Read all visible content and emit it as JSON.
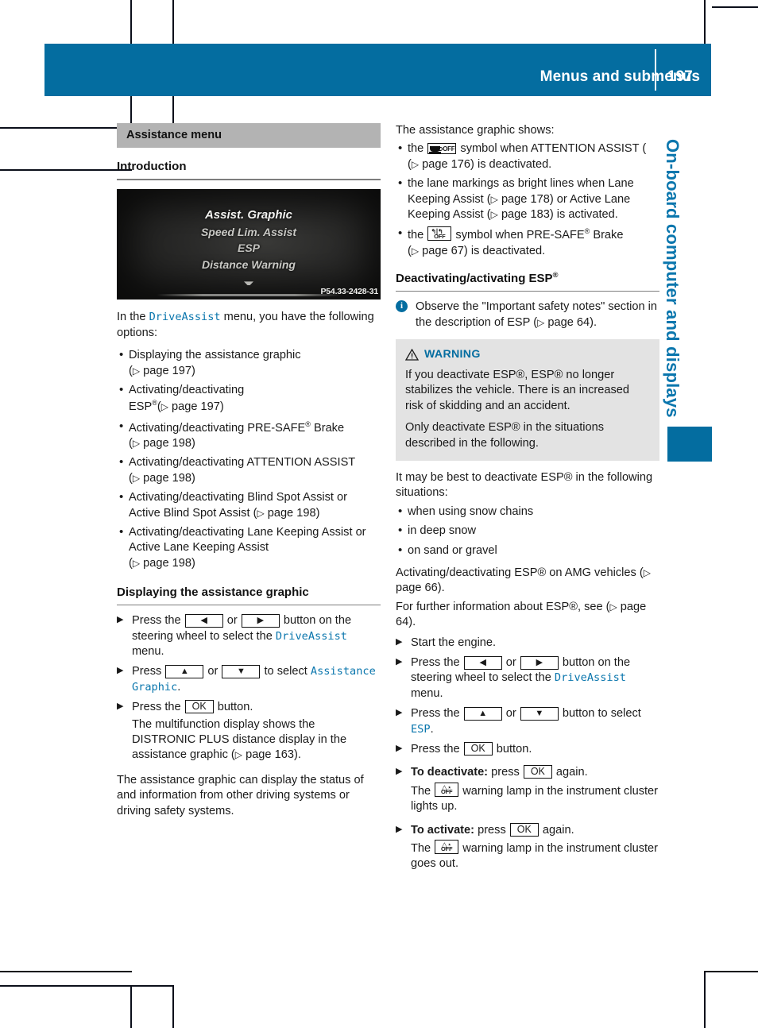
{
  "header": {
    "title": "Menus and submenus",
    "page_number": "197"
  },
  "side_tab": {
    "label": "On-board computer and displays"
  },
  "left_column": {
    "section_title": "Assistance menu",
    "intro_heading": "Introduction",
    "mfd_image": {
      "items": [
        "Assist. Graphic",
        "Speed Lim. Assist",
        "ESP",
        "Distance Warning"
      ],
      "code": "P54.33-2428-31"
    },
    "intro_lead_a": "In the ",
    "intro_menu_name": "DriveAssist",
    "intro_lead_b": " menu, you have the following options:",
    "options": [
      {
        "text": "Displaying the assistance graphic",
        "ref": "page 197",
        "ref_on_new_line": true
      },
      {
        "text": "Activating/deactivating ESP®",
        "ref": "page 197",
        "ref_on_new_line": false
      },
      {
        "text": "Activating/deactivating PRE-SAFE® Brake",
        "ref": "page 198",
        "ref_on_new_line": true
      },
      {
        "text": "Activating/deactivating ATTENTION ASSIST",
        "ref": "page 198",
        "ref_on_new_line": false
      },
      {
        "text": "Activating/deactivating Blind Spot Assist or Active Blind Spot Assist",
        "ref": "page 198",
        "ref_on_new_line": false
      },
      {
        "text": "Activating/deactivating Lane Keeping Assist or Active Lane Keeping Assist",
        "ref": "page 198",
        "ref_on_new_line": true
      }
    ],
    "display_heading": "Displaying the assistance graphic",
    "step1_a": "Press the ",
    "step1_or": " or ",
    "step1_b": " button on the steering wheel to select the ",
    "step1_menu": "DriveAssist",
    "step1_c": " menu.",
    "step2_a": "Press ",
    "step2_or": " or ",
    "step2_b": " to select ",
    "step2_menu": "Assistance Graphic",
    "step2_c": ".",
    "step3_a": "Press the ",
    "step3_ok": "OK",
    "step3_b": " button.",
    "step3_detail_a": "The multifunction display shows the DISTRONIC PLUS distance display in the assistance graphic (",
    "step3_detail_ref": "page 163",
    "step3_detail_b": ").",
    "closing": "The assistance graphic can display the status of and information from other driving systems or driving safety systems."
  },
  "right_column": {
    "lead": "The assistance graphic shows:",
    "bullets": [
      {
        "before": "the ",
        "symbol": "attention-assist-off-symbol",
        "after": " symbol when ATTENTION ASSIST (",
        "ref": "page 176",
        "tail": ") is deactivated."
      },
      {
        "before": "the lane markings as bright lines when Lane Keeping Assist (",
        "ref": "page 178",
        "middle": ") or Active Lane Keeping Assist (",
        "ref2": "page 183",
        "tail": ") is activated."
      },
      {
        "before": "the ",
        "symbol": "pre-safe-brake-off-symbol",
        "after": " symbol when PRE-SAFE® Brake (",
        "ref": "page 67",
        "tail": ") is deactivated."
      }
    ],
    "esp_heading": "Deactivating/activating ESP®",
    "note_a": "Observe the \"Important safety notes\" section in the description of ESP (",
    "note_ref": "page 64",
    "note_b": ").",
    "warning": {
      "label": "WARNING",
      "para1": "If you deactivate ESP®, ESP® no longer stabilizes the vehicle. There is an increased risk of skidding and an accident.",
      "para2": "Only deactivate ESP® in the situations described in the following."
    },
    "situations_lead": "It may be best to deactivate ESP® in the following situations:",
    "situations": [
      "when using snow chains",
      "in deep snow",
      "on sand or gravel"
    ],
    "amg_a": "Activating/deactivating ESP® on AMG vehicles (",
    "amg_ref": "page 66",
    "amg_b": ").",
    "further_a": "For further information about ESP®, see (",
    "further_ref": "page 64",
    "further_b": ").",
    "step_start_engine": "Start the engine.",
    "step_press_a": "Press the ",
    "step_press_or": " or ",
    "step_press_b": " button on the steering wheel to select the ",
    "step_press_menu": "DriveAssist",
    "step_press_c": " menu.",
    "step_updown_a": "Press the ",
    "step_updown_or": " or ",
    "step_updown_b": " button to select ",
    "step_updown_menu": "ESP",
    "step_updown_c": ".",
    "step_ok_a": "Press the ",
    "step_ok_key": "OK",
    "step_ok_b": " button.",
    "deactivate_label": "To deactivate:",
    "deactivate_a": " press ",
    "deactivate_key": "OK",
    "deactivate_b": " again.",
    "deactivate_detail_a": "The ",
    "deactivate_detail_b": " warning lamp in the instrument cluster lights up.",
    "activate_label": "To activate:",
    "activate_a": " press ",
    "activate_key": "OK",
    "activate_b": " again.",
    "activate_detail_a": "The ",
    "activate_detail_b": " warning lamp in the instrument cluster goes out."
  },
  "symbols": {
    "off_text": "OFF",
    "esp_lamp_glyph": "⬚"
  },
  "colors": {
    "brand_blue": "#046da0",
    "link_blue": "#0a76ad",
    "section_gray": "#b3b3b3",
    "warning_bg": "#e3e3e3"
  }
}
